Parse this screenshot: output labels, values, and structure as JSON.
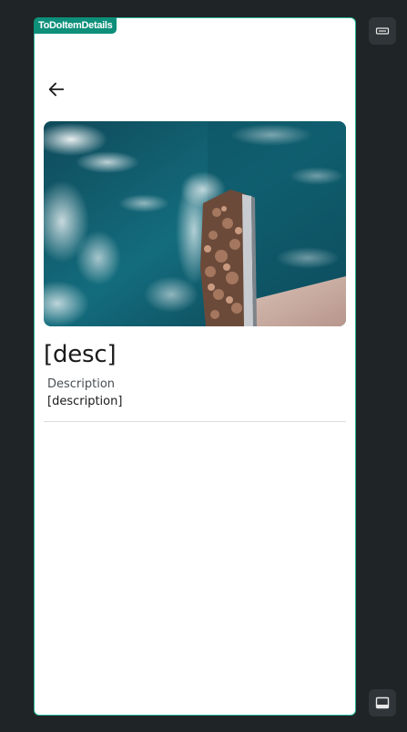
{
  "frame": {
    "label": "ToDoItemDetails"
  },
  "header": {
    "back_icon": "arrow-left-icon"
  },
  "item": {
    "title": "[desc]",
    "description_label": "Description",
    "description_value": "[description]"
  },
  "side_controls": {
    "top_icon": "keyboard-icon",
    "bottom_icon": "dock-bottom-icon"
  }
}
